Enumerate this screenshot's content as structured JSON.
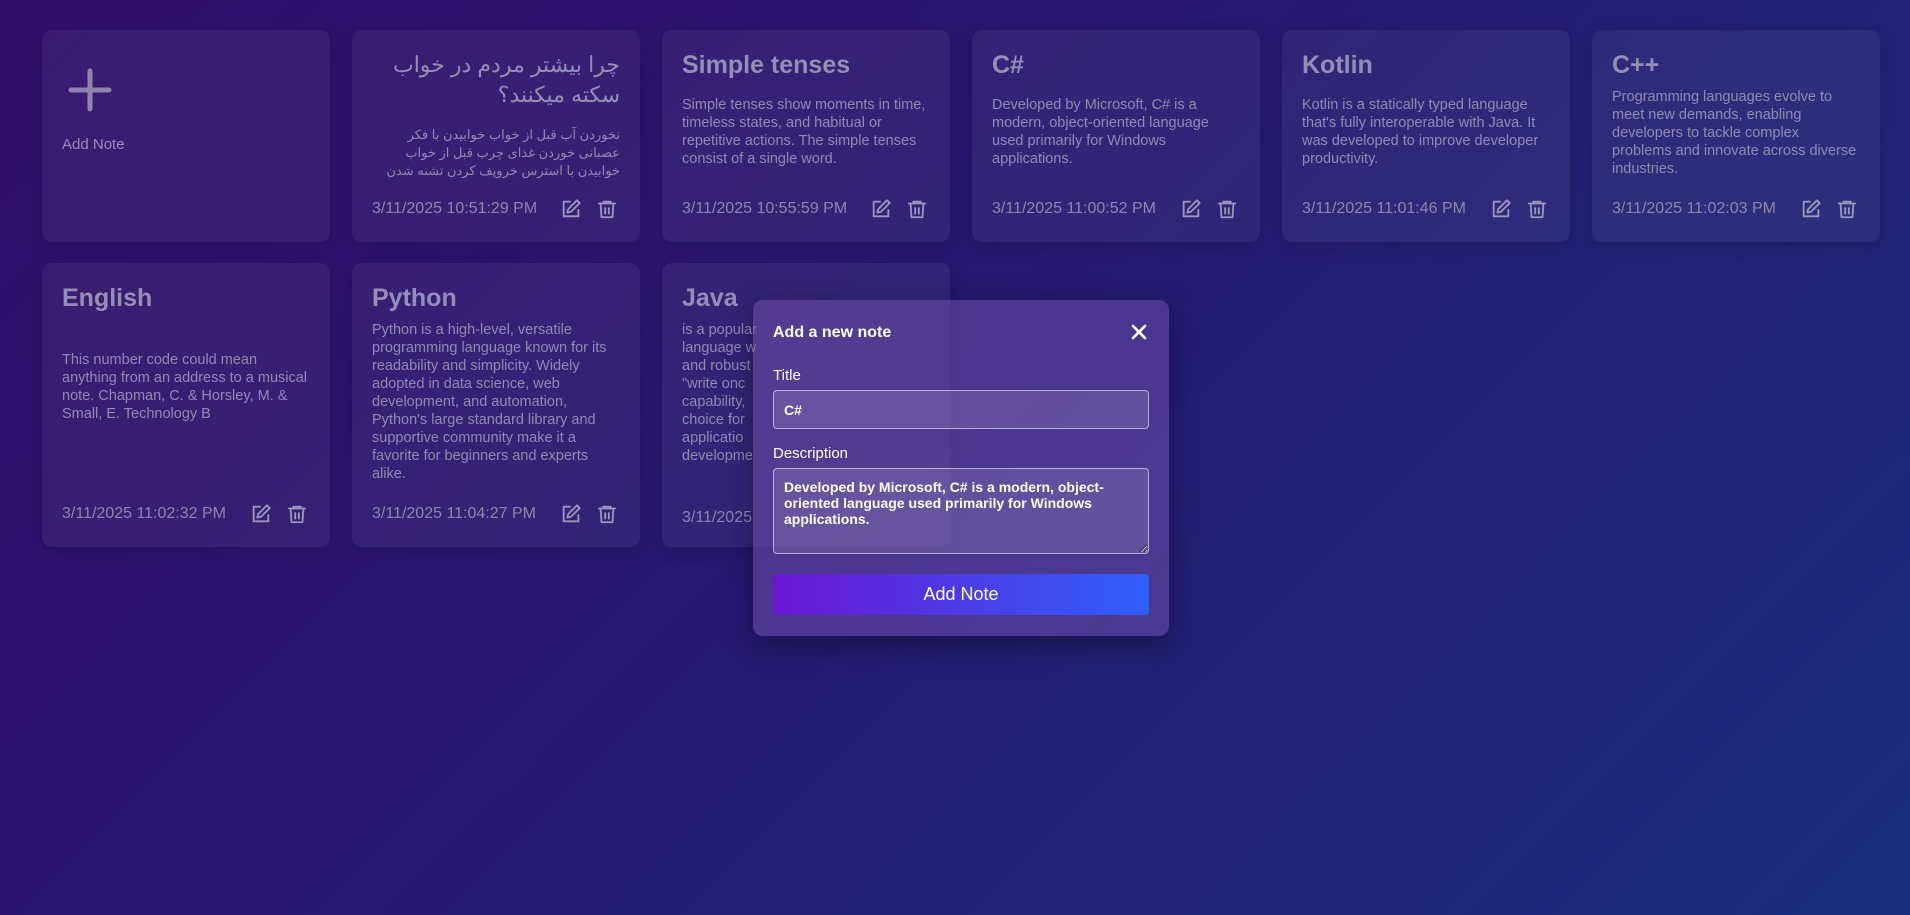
{
  "add_note": {
    "label": "Add Note",
    "icon": "plus-icon"
  },
  "notes": [
    {
      "title": "چرا بیشتر مردم در خواب سکته میکنند؟",
      "description": "نخوردن آب قبل از خواب خوابیدن با فکر عصبانی خوردن غذای چرب قبل از خواب خوابیدن با استرس خروپف کردن تشنه شدن در خواب و نخوردن آب",
      "date": "3/11/2025 10:51:29 PM"
    },
    {
      "title": "Simple tenses",
      "description": "Simple tenses show moments in time, timeless states, and habitual or repetitive actions. The simple tenses consist of a single word.",
      "date": "3/11/2025 10:55:59 PM"
    },
    {
      "title": "C#",
      "description": "Developed by Microsoft, C# is a modern, object-oriented language used primarily for Windows applications.",
      "date": "3/11/2025 11:00:52 PM"
    },
    {
      "title": "Kotlin",
      "description": "Kotlin is a statically typed language that's fully interoperable with Java. It was developed to improve developer productivity.",
      "date": "3/11/2025 11:01:46 PM"
    },
    {
      "title": "C++",
      "description": "Programming languages evolve to meet new demands, enabling developers to tackle complex problems and innovate across diverse industries.",
      "date": "3/11/2025 11:02:03 PM"
    },
    {
      "title": "English",
      "description": "This number code could mean anything from an address to a musical note. Chapman, C. & Horsley, M. & Small, E. Technology B",
      "date": "3/11/2025 11:02:32 PM"
    },
    {
      "title": "Python",
      "description": "Python is a high-level, versatile programming language known for its readability and simplicity. Widely adopted in data science, web development, and automation, Python's large standard library and supportive community make it a favorite for beginners and experts alike.",
      "date": "3/11/2025 11:04:27 PM"
    },
    {
      "title": "Java",
      "description": "is a popular language w and robust \"write onc capability, choice for applicatio developme",
      "date": "3/11/2025"
    }
  ],
  "modal": {
    "title": "Add a new note",
    "close_icon": "close-icon",
    "title_label": "Title",
    "title_value": "C#",
    "description_label": "Description",
    "description_value": "Developed by Microsoft, C# is a modern, object-oriented language used primarily for Windows applications.",
    "submit_label": "Add Note"
  },
  "colors": {
    "bg_start": "#3a0c72",
    "bg_end": "#1b3a8c",
    "button_start": "#6a17d2",
    "button_end": "#2f5ffb"
  }
}
